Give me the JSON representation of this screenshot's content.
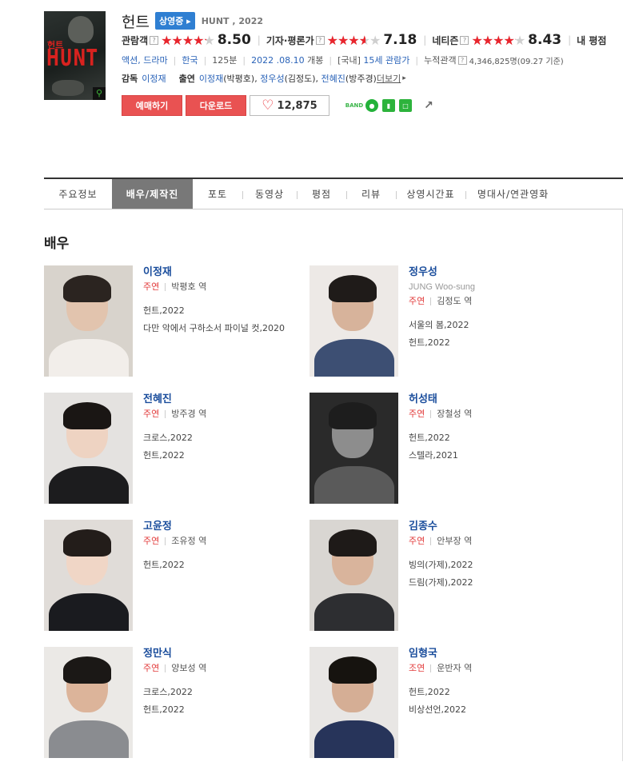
{
  "movie": {
    "title": "헌트",
    "status_badge": "상영중",
    "english_title": "HUNT , 2022",
    "poster_title": "HUNT",
    "poster_title_ko": "헌트"
  },
  "ratings": [
    {
      "label": "관람객",
      "score": "8.50",
      "fill_percent": 85
    },
    {
      "label": "기자·평론가",
      "score": "7.18",
      "fill_percent": 72
    },
    {
      "label": "네티즌",
      "score": "8.43",
      "fill_percent": 84
    },
    {
      "label": "내 평점"
    }
  ],
  "info": {
    "genre": "액션, 드라마",
    "country": "한국",
    "runtime": "125분",
    "release_date": "2022 .08.10",
    "release_suffix": "개봉",
    "rating_prefix": "[국내]",
    "rating": "15세 관람가",
    "audience_label": "누적관객",
    "audience_count": "4,346,825명",
    "audience_date": "(09.27 기준)"
  },
  "crew": {
    "director_label": "감독",
    "director": "이정재",
    "cast_label": "출연",
    "cast_line": [
      {
        "actor": "이정재",
        "role": "(박평호)"
      },
      {
        "actor": "정우성",
        "role": "(김정도)"
      },
      {
        "actor": "전혜진",
        "role": "(방주경)"
      }
    ],
    "more": "더보기"
  },
  "buttons": {
    "reserve": "예매하기",
    "download": "다운로드",
    "like_count": "12,875"
  },
  "tabs": [
    "주요정보",
    "배우/제작진",
    "포토",
    "동영상",
    "평점",
    "리뷰",
    "상영시간표",
    "명대사/연관영화"
  ],
  "section_title": "배우",
  "cast": [
    {
      "name": "이정재",
      "english": "",
      "role_kind": "주연",
      "role": "박평호 역",
      "works": [
        "헌트,2022",
        "다만 악에서 구하소서 파이널 컷,2020"
      ]
    },
    {
      "name": "정우성",
      "english": "JUNG Woo-sung",
      "role_kind": "주연",
      "role": "김정도 역",
      "works": [
        "서울의 봄,2022",
        "헌트,2022"
      ]
    },
    {
      "name": "전혜진",
      "english": "",
      "role_kind": "주연",
      "role": "방주경 역",
      "works": [
        "크로스,2022",
        "헌트,2022"
      ]
    },
    {
      "name": "허성태",
      "english": "",
      "role_kind": "주연",
      "role": "장철성 역",
      "works": [
        "헌트,2022",
        "스텔라,2021"
      ]
    },
    {
      "name": "고윤정",
      "english": "",
      "role_kind": "주연",
      "role": "조유정 역",
      "works": [
        "헌트,2022"
      ]
    },
    {
      "name": "김종수",
      "english": "",
      "role_kind": "주연",
      "role": "안부장 역",
      "works": [
        "빙의(가제),2022",
        "드림(가제),2022"
      ]
    },
    {
      "name": "정만식",
      "english": "",
      "role_kind": "주연",
      "role": "양보성 역",
      "works": [
        "크로스,2022",
        "헌트,2022"
      ]
    },
    {
      "name": "임형국",
      "english": "",
      "role_kind": "조연",
      "role": "운반자 역",
      "works": [
        "헌트,2022",
        "비상선언,2022"
      ]
    }
  ],
  "icons": {
    "help": "question-icon",
    "heart": "heart-icon",
    "share": "share-icon"
  },
  "colors": {
    "accent_red": "#e95252",
    "star_red": "#e9252d",
    "link_blue": "#2a63b8",
    "badge_blue": "#2f7fd2",
    "tab_active": "#787878"
  }
}
